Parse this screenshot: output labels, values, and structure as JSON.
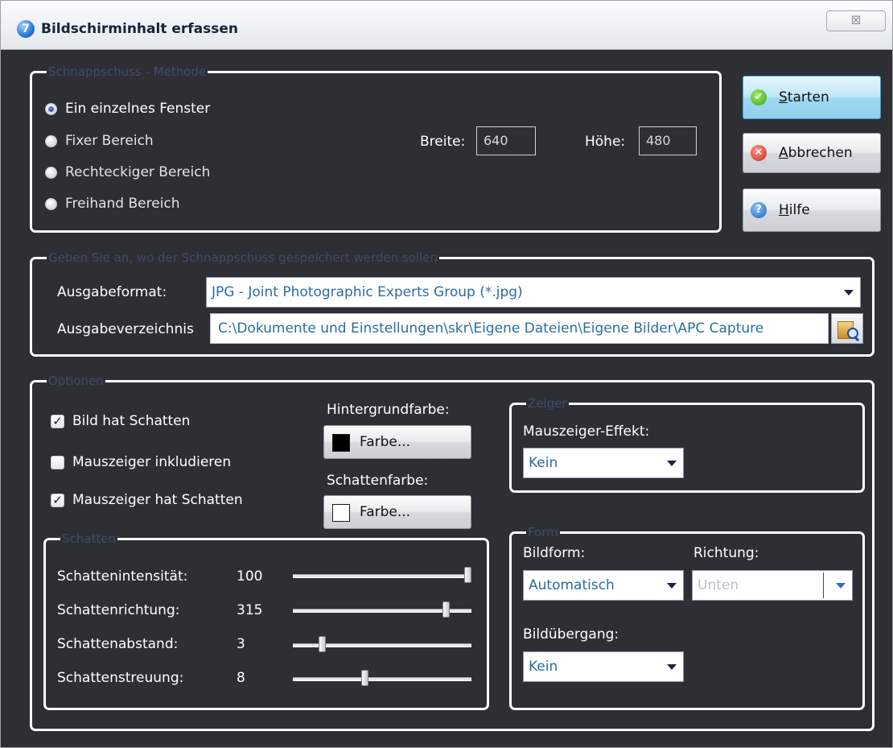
{
  "window": {
    "title": "Bildschirminhalt erfassen",
    "icon": "app-icon",
    "close_glyph": "☒"
  },
  "method": {
    "legend": "Schnappschuss - Methode",
    "options": [
      "Ein einzelnes Fenster",
      "Fixer Bereich",
      "Rechteckiger Bereich",
      "Freihand Bereich"
    ],
    "selected_index": 0,
    "width_label": "Breite:",
    "width_value": "640",
    "height_label": "Höhe:",
    "height_value": "480"
  },
  "buttons": {
    "start": {
      "prefix": "",
      "mnemonic": "S",
      "rest": "tarten",
      "icon": "check-icon"
    },
    "cancel": {
      "mnemonic": "A",
      "rest": "bbrechen",
      "icon": "cancel-icon"
    },
    "help": {
      "mnemonic": "H",
      "rest": "ilfe",
      "icon": "help-icon"
    }
  },
  "output": {
    "legend": "Geben Sie an, wo der Schnappschuss gespeichert werden sollen",
    "format_label": "Ausgabeformat:",
    "format_value": "JPG - Joint Photographic Experts Group (*.jpg)",
    "dir_label": "Ausgabeverzeichnis",
    "dir_value": "C:\\Dokumente und Einstellungen\\skr\\Eigene Dateien\\Eigene Bilder\\APC Capture",
    "browse_icon": "folder-search-icon"
  },
  "options": {
    "legend": "Optionen",
    "checks": [
      {
        "label": "Bild hat Schatten",
        "checked": true
      },
      {
        "label": "Mauszeiger inkludieren",
        "checked": false
      },
      {
        "label": "Mauszeiger hat Schatten",
        "checked": true
      }
    ],
    "bg_color_label": "Hintergrundfarbe:",
    "bg_color_button": "Farbe...",
    "bg_color_value": "#000000",
    "shadow_color_label": "Schattenfarbe:",
    "shadow_color_button": "Farbe...",
    "shadow_color_value": "#ffffff"
  },
  "shadow": {
    "legend": "Schatten",
    "rows": [
      {
        "label": "Schattenintensität:",
        "value": "100",
        "fraction": 1.0
      },
      {
        "label": "Schattenrichtung:",
        "value": "315",
        "fraction": 0.875
      },
      {
        "label": "Schattenabstand:",
        "value": "3",
        "fraction": 0.15
      },
      {
        "label": "Schattenstreuung:",
        "value": "8",
        "fraction": 0.4
      }
    ]
  },
  "pointer": {
    "legend": "Zeiger",
    "effect_label": "Mauszeiger-Effekt:",
    "effect_value": "Kein"
  },
  "form": {
    "legend": "Form",
    "shape_label": "Bildform:",
    "shape_value": "Automatisch",
    "direction_label": "Richtung:",
    "direction_value": "Unten",
    "transition_label": "Bildübergang:",
    "transition_value": "Kein"
  },
  "colors": {
    "accent": "#2b6ca0",
    "background": "#2e2f35",
    "frame": "#ffffff"
  }
}
